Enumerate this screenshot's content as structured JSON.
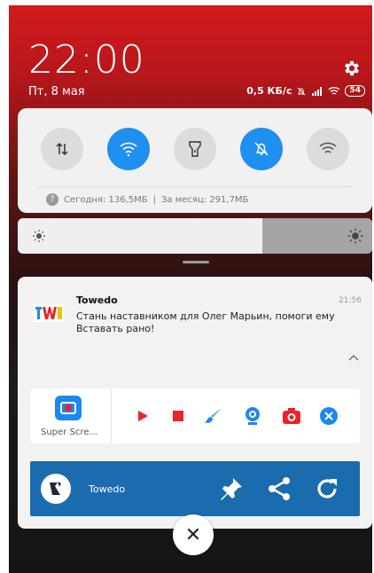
{
  "status": {
    "time": "22:00",
    "date": "Пт, 8 мая",
    "net_speed": "0,5 КБ/с",
    "battery": "54"
  },
  "quick_settings": {
    "toggles": [
      {
        "name": "data",
        "state": "off",
        "icon": "arrows-updown-icon"
      },
      {
        "name": "wifi",
        "state": "on",
        "icon": "wifi-icon"
      },
      {
        "name": "flashlight",
        "state": "off",
        "icon": "flashlight-icon"
      },
      {
        "name": "silent",
        "state": "on",
        "icon": "bell-off-icon"
      },
      {
        "name": "wifi-scan",
        "state": "off",
        "icon": "wifi-icon"
      }
    ],
    "usage_today": "Сегодня: 136,5МБ",
    "usage_sep": "|",
    "usage_month": "За месяц: 291,7МБ",
    "brightness_level": 0.69
  },
  "notification": {
    "app_name": "Towedo",
    "time": "21:56",
    "message": "Стань наставником для Олег Марьин, помоги ему Вставать рано!"
  },
  "super_screen": {
    "label": "Super Scre...",
    "tools": [
      "record-icon",
      "stop-icon",
      "brush-icon",
      "webcam-icon",
      "camera-icon",
      "close-icon"
    ]
  },
  "towedo_bar": {
    "name": "Towedo",
    "actions": [
      "pin-icon",
      "share-icon",
      "refresh-icon"
    ]
  },
  "colors": {
    "accent": "#1f8ff0",
    "bar": "#1a6cae",
    "red": "#e8232a"
  }
}
